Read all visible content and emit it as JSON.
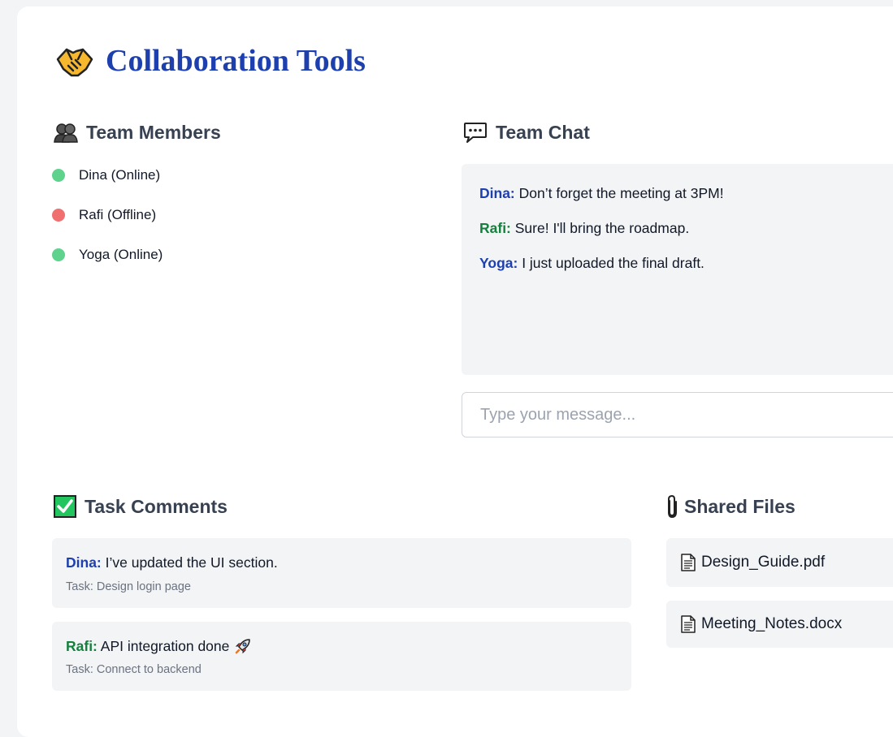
{
  "header": {
    "title": "Collaboration Tools",
    "icon": "handshake-icon"
  },
  "team_members": {
    "heading": "Team Members",
    "icon": "people-icon",
    "members": [
      {
        "label": "Dina (Online)",
        "status": "online",
        "color": "#5fd38d"
      },
      {
        "label": "Rafi (Offline)",
        "status": "offline",
        "color": "#f07070"
      },
      {
        "label": "Yoga (Online)",
        "status": "online",
        "color": "#5fd38d"
      }
    ]
  },
  "team_chat": {
    "heading": "Team Chat",
    "icon": "speech-balloon-icon",
    "messages": [
      {
        "sender": "Dina:",
        "text": " Don’t forget the meeting at 3PM!",
        "color": "#1e40af"
      },
      {
        "sender": "Rafi:",
        "text": " Sure! I'll bring the roadmap.",
        "color": "#15803d"
      },
      {
        "sender": "Yoga:",
        "text": " I just uploaded the final draft.",
        "color": "#1e40af"
      }
    ],
    "input_placeholder": "Type your message...",
    "input_value": ""
  },
  "task_comments": {
    "heading": "Task Comments",
    "icon": "check-mark-icon",
    "comments": [
      {
        "author": "Dina:",
        "text": " I’ve updated the UI section.",
        "task": "Task: Design login page",
        "color": "#1e40af"
      },
      {
        "author": "Rafi:",
        "text": " API integration done",
        "task": "Task: Connect to backend",
        "color": "#15803d",
        "emoji": "rocket-icon"
      }
    ]
  },
  "shared_files": {
    "heading": "Shared Files",
    "icon": "paperclip-icon",
    "files": [
      {
        "name": "Design_Guide.pdf",
        "icon": "document-icon"
      },
      {
        "name": "Meeting_Notes.docx",
        "icon": "document-icon"
      }
    ]
  },
  "colors": {
    "accent": "#1e40af",
    "online": "#5fd38d",
    "offline": "#f07070",
    "panel": "#f3f4f6"
  }
}
